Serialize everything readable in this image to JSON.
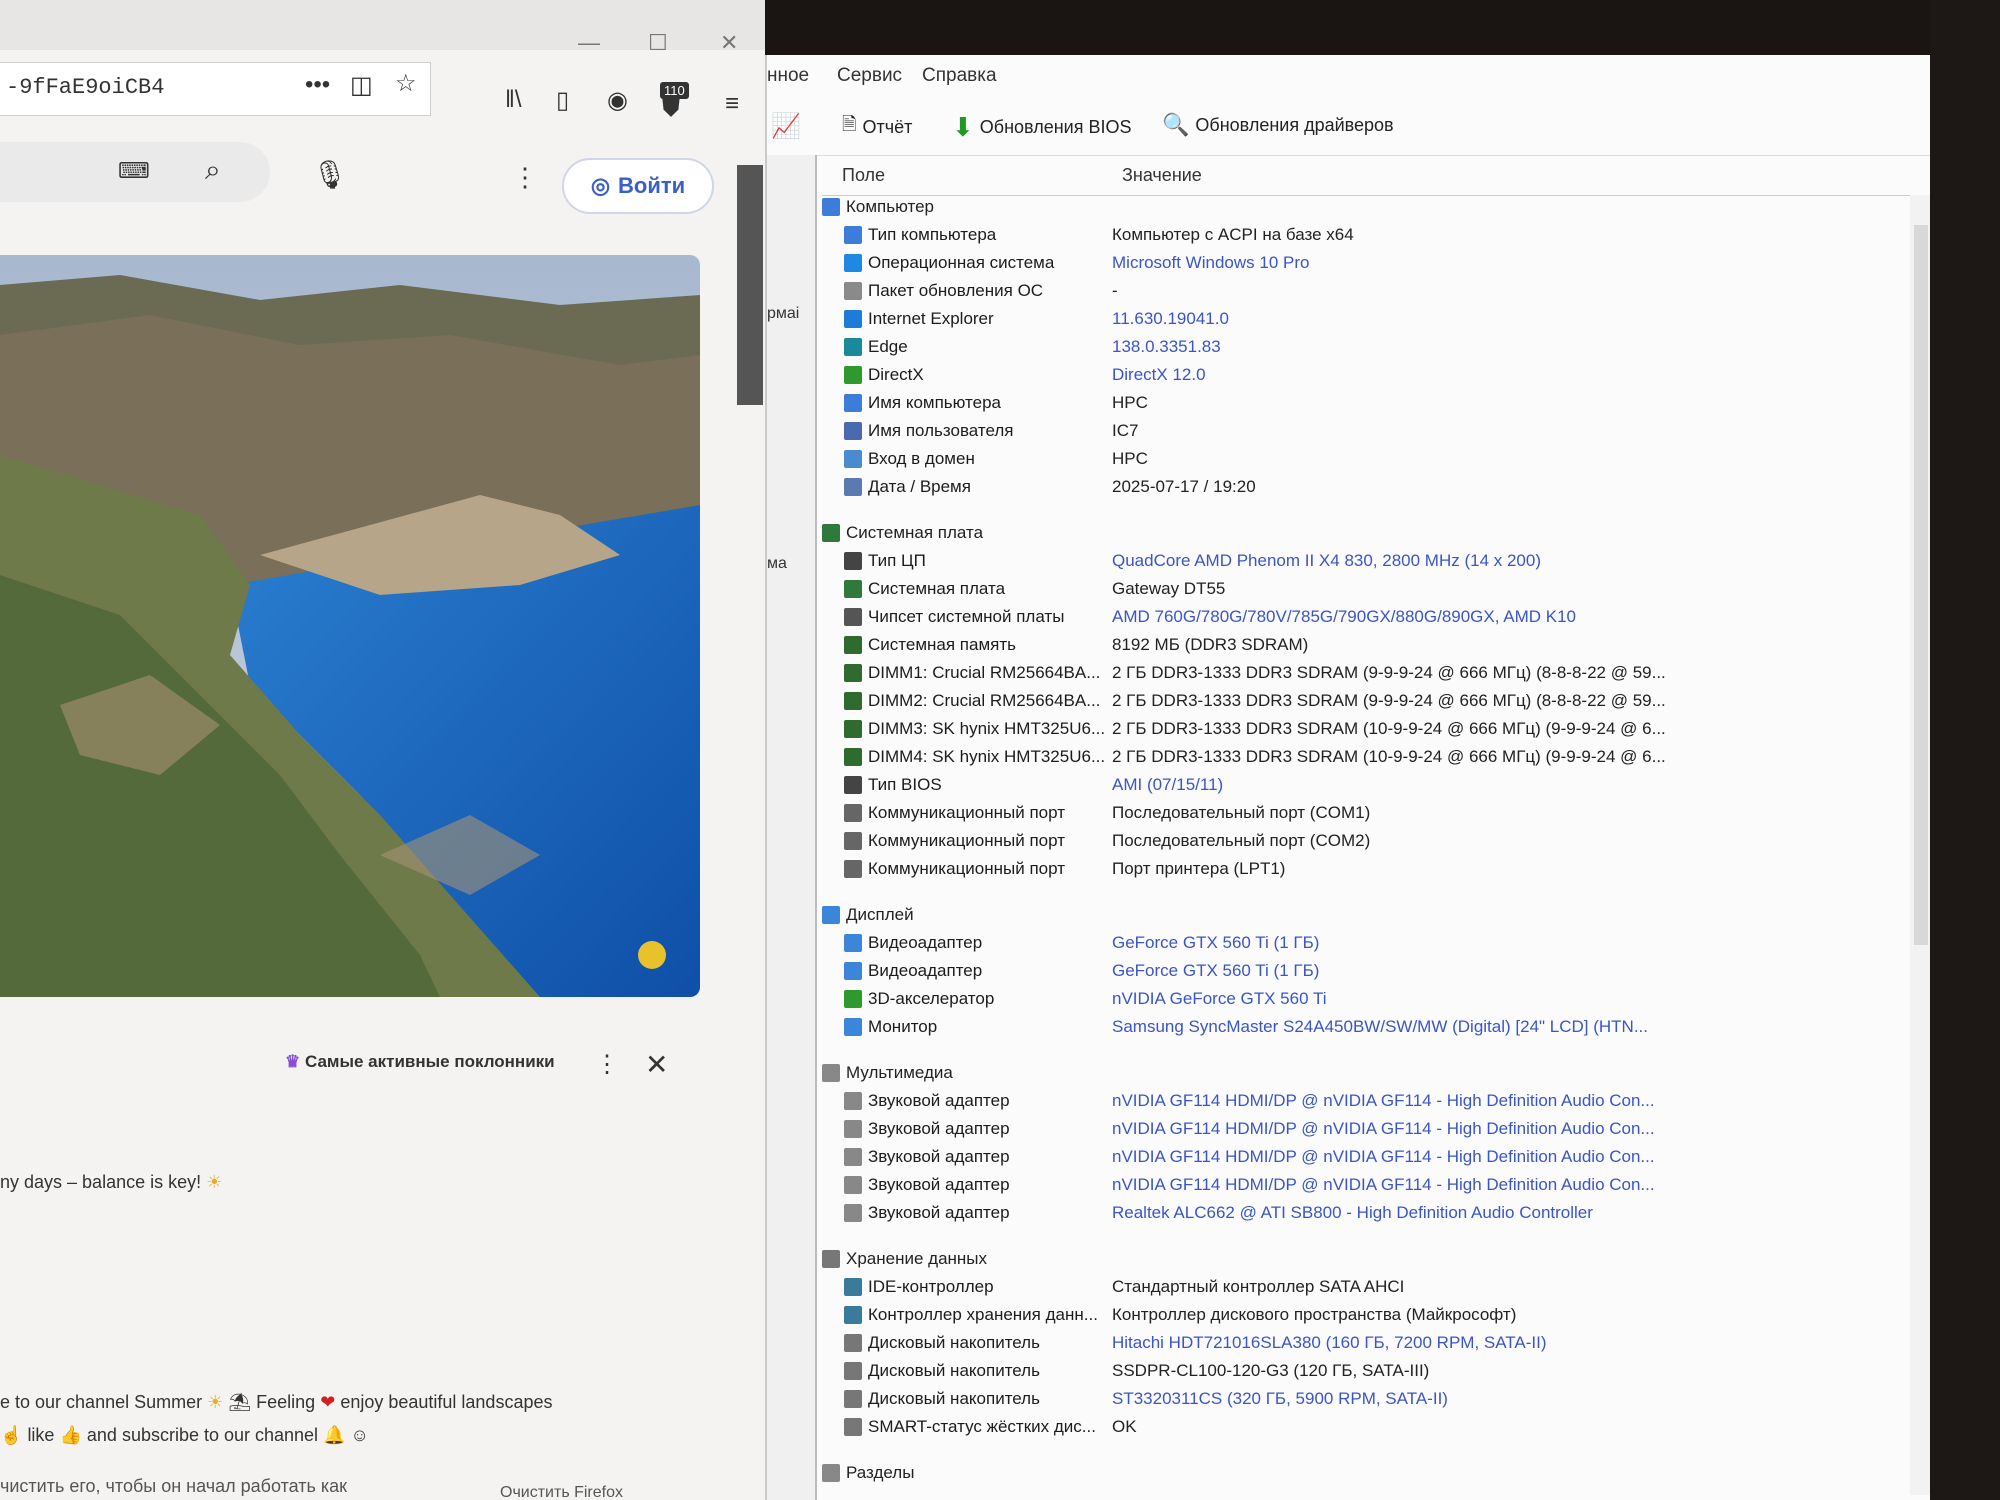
{
  "browser": {
    "url_fragment": "-9fFaE9oiCB4",
    "login_label": "Войти",
    "badge_count": "110",
    "fans_label": "Самые активные поклонники",
    "chat": [
      "ny days – balance is key!",
      "e to our channel Summer",
      "Feeling",
      "enjoy beautiful landscapes",
      "like",
      "and subscribe to our channel",
      "чистить его, чтобы он начал работать как",
      "Очистить Firefox"
    ]
  },
  "aida": {
    "menu": [
      "нное",
      "Сервис",
      "Справка"
    ],
    "toolbar": {
      "report": "Отчёт",
      "bios_updates": "Обновления BIOS",
      "driver_updates": "Обновления драйверов"
    },
    "left_fragments": [
      "рмаі",
      "ма"
    ],
    "columns": {
      "field": "Поле",
      "value": "Значение"
    },
    "rows": [
      {
        "section": true,
        "field": "Компьютер",
        "icon": "computer-icon"
      },
      {
        "field": "Тип компьютера",
        "value": "Компьютер с ACPI на базе x64",
        "icon": "computer-icon"
      },
      {
        "field": "Операционная система",
        "value": "Microsoft Windows 10 Pro",
        "link": true,
        "icon": "windows-icon"
      },
      {
        "field": "Пакет обновления ОС",
        "value": "-",
        "icon": "package-icon"
      },
      {
        "field": "Internet Explorer",
        "value": "11.630.19041.0",
        "link": true,
        "icon": "ie-icon"
      },
      {
        "field": "Edge",
        "value": "138.0.3351.83",
        "link": true,
        "icon": "edge-icon"
      },
      {
        "field": "DirectX",
        "value": "DirectX 12.0",
        "link": true,
        "icon": "directx-icon"
      },
      {
        "field": "Имя компьютера",
        "value": "HPC",
        "icon": "computer-icon"
      },
      {
        "field": "Имя пользователя",
        "value": "IC7",
        "icon": "user-icon"
      },
      {
        "field": "Вход в домен",
        "value": "HPC",
        "icon": "domain-icon"
      },
      {
        "field": "Дата / Время",
        "value": "2025-07-17 / 19:20",
        "icon": "clock-icon"
      },
      {
        "section": true,
        "field": "Системная плата",
        "icon": "motherboard-icon"
      },
      {
        "field": "Тип ЦП",
        "value": "QuadCore AMD Phenom II X4 830, 2800 MHz (14 x 200)",
        "link": true,
        "icon": "cpu-icon"
      },
      {
        "field": "Системная плата",
        "value": "Gateway DT55",
        "icon": "motherboard-icon"
      },
      {
        "field": "Чипсет системной платы",
        "value": "AMD 760G/780G/780V/785G/790GX/880G/890GX, AMD K10",
        "link": true,
        "icon": "chipset-icon"
      },
      {
        "field": "Системная память",
        "value": "8192 МБ  (DDR3 SDRAM)",
        "icon": "memory-icon"
      },
      {
        "field": "DIMM1: Crucial RM25664BA...",
        "value": "2 ГБ DDR3-1333 DDR3 SDRAM  (9-9-9-24 @ 666 МГц)  (8-8-8-22 @ 59...",
        "icon": "memory-icon"
      },
      {
        "field": "DIMM2: Crucial RM25664BA...",
        "value": "2 ГБ DDR3-1333 DDR3 SDRAM  (9-9-9-24 @ 666 МГц)  (8-8-8-22 @ 59...",
        "icon": "memory-icon"
      },
      {
        "field": "DIMM3: SK hynix HMT325U6...",
        "value": "2 ГБ DDR3-1333 DDR3 SDRAM  (10-9-9-24 @ 666 МГц)  (9-9-9-24 @ 6...",
        "icon": "memory-icon"
      },
      {
        "field": "DIMM4: SK hynix HMT325U6...",
        "value": "2 ГБ DDR3-1333 DDR3 SDRAM  (10-9-9-24 @ 666 МГц)  (9-9-9-24 @ 6...",
        "icon": "memory-icon"
      },
      {
        "field": "Тип BIOS",
        "value": "AMI (07/15/11)",
        "link": true,
        "icon": "bios-icon"
      },
      {
        "field": "Коммуникационный порт",
        "value": "Последовательный порт (COM1)",
        "icon": "port-icon"
      },
      {
        "field": "Коммуникационный порт",
        "value": "Последовательный порт (COM2)",
        "icon": "port-icon"
      },
      {
        "field": "Коммуникационный порт",
        "value": "Порт принтера (LPT1)",
        "icon": "port-icon"
      },
      {
        "section": true,
        "field": "Дисплей",
        "icon": "display-icon"
      },
      {
        "field": "Видеоадаптер",
        "value": "GeForce GTX 560 Ti  (1 ГБ)",
        "link": true,
        "icon": "display-icon"
      },
      {
        "field": "Видеоадаптер",
        "value": "GeForce GTX 560 Ti  (1 ГБ)",
        "link": true,
        "icon": "display-icon"
      },
      {
        "field": "3D-акселератор",
        "value": "nVIDIA GeForce GTX 560 Ti",
        "link": true,
        "icon": "directx-icon"
      },
      {
        "field": "Монитор",
        "value": "Samsung SyncMaster S24A450BW/SW/MW (Digital)  [24\" LCD]  (HTN...",
        "link": true,
        "icon": "monitor-icon"
      },
      {
        "section": true,
        "field": "Мультимедиа",
        "icon": "speaker-icon"
      },
      {
        "field": "Звуковой адаптер",
        "value": "nVIDIA GF114 HDMI/DP @ nVIDIA GF114 - High Definition Audio Con...",
        "link": true,
        "icon": "speaker-icon"
      },
      {
        "field": "Звуковой адаптер",
        "value": "nVIDIA GF114 HDMI/DP @ nVIDIA GF114 - High Definition Audio Con...",
        "link": true,
        "icon": "speaker-icon"
      },
      {
        "field": "Звуковой адаптер",
        "value": "nVIDIA GF114 HDMI/DP @ nVIDIA GF114 - High Definition Audio Con...",
        "link": true,
        "icon": "speaker-icon"
      },
      {
        "field": "Звуковой адаптер",
        "value": "nVIDIA GF114 HDMI/DP @ nVIDIA GF114 - High Definition Audio Con...",
        "link": true,
        "icon": "speaker-icon"
      },
      {
        "field": "Звуковой адаптер",
        "value": "Realtek ALC662 @ ATI SB800 - High Definition Audio Controller",
        "link": true,
        "icon": "speaker-icon"
      },
      {
        "section": true,
        "field": "Хранение данных",
        "icon": "drive-icon"
      },
      {
        "field": "IDE-контроллер",
        "value": "Стандартный контроллер SATA AHCI",
        "icon": "controller-icon"
      },
      {
        "field": "Контроллер хранения данн...",
        "value": "Контроллер дискового пространства (Майкрософт)",
        "icon": "controller-icon"
      },
      {
        "field": "Дисковый накопитель",
        "value": "Hitachi HDT721016SLA380  (160 ГБ, 7200 RPM, SATA-II)",
        "link": true,
        "icon": "drive-icon"
      },
      {
        "field": "Дисковый накопитель",
        "value": "SSDPR-CL100-120-G3  (120 ГБ, SATA-III)",
        "icon": "drive-icon"
      },
      {
        "field": "Дисковый накопитель",
        "value": "ST3320311CS  (320 ГБ, 5900 RPM, SATA-II)",
        "link": true,
        "icon": "drive-icon"
      },
      {
        "field": "SMART-статус жёстких дис...",
        "value": "OK",
        "icon": "drive-icon"
      },
      {
        "section": true,
        "field": "Разделы",
        "icon": "partition-icon"
      }
    ]
  },
  "colors": {
    "link_blue": "#3a55c8",
    "section_gap": "#fbfbfb"
  }
}
